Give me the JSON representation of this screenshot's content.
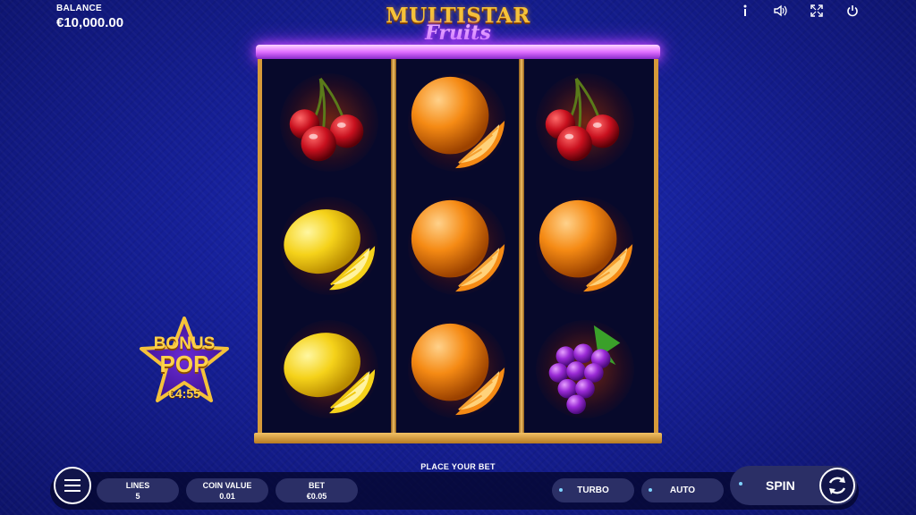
{
  "balance": {
    "label": "BALANCE",
    "value": "€10,000.00"
  },
  "top_icons": [
    "info-icon",
    "sound-icon",
    "fullscreen-icon",
    "power-icon"
  ],
  "logo": {
    "line1": "MULTISTAR",
    "line2": "Fruits"
  },
  "reels": [
    [
      "cherries",
      "lemon",
      "lemon"
    ],
    [
      "orange",
      "orange",
      "orange"
    ],
    [
      "cherries",
      "orange",
      "grapes"
    ]
  ],
  "bonus_pop": {
    "line1": "BONUS",
    "line2": "POP",
    "amount": "€4:55"
  },
  "bottom": {
    "prompt": "PLACE YOUR BET",
    "lines": {
      "label": "LINES",
      "value": "5"
    },
    "coin_value": {
      "label": "COIN VALUE",
      "value": "0.01"
    },
    "bet": {
      "label": "BET",
      "value": "€0.05"
    },
    "turbo": "TURBO",
    "auto": "AUTO",
    "spin": "SPIN"
  },
  "colors": {
    "accent_gold": "#f5c23a",
    "neon_purple": "#d050ff",
    "background": "#16209a"
  }
}
